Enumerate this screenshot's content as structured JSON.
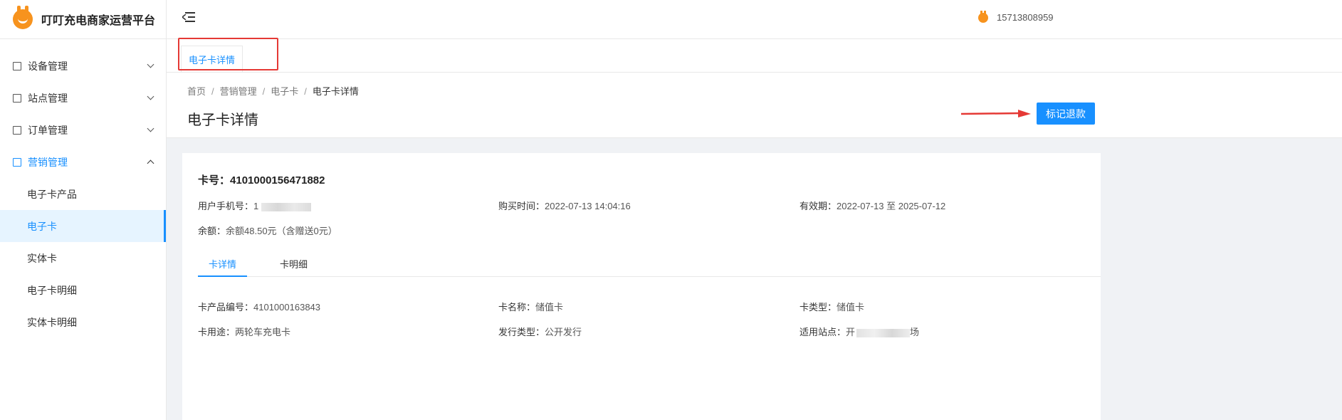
{
  "brand": {
    "title": "叮叮充电商家运营平台",
    "logo_icon": "plug-smile-logo"
  },
  "sidebar": {
    "items": [
      {
        "label": "设备管理",
        "icon": "device-icon"
      },
      {
        "label": "站点管理",
        "icon": "site-icon"
      },
      {
        "label": "订单管理",
        "icon": "order-icon"
      },
      {
        "label": "营销管理",
        "icon": "gift-icon"
      }
    ],
    "submenu": [
      {
        "label": "电子卡产品"
      },
      {
        "label": "电子卡"
      },
      {
        "label": "实体卡"
      },
      {
        "label": "电子卡明细"
      },
      {
        "label": "实体卡明细"
      }
    ]
  },
  "header": {
    "user_phone": "15713808959"
  },
  "tabs": {
    "open_tab": "电子卡详情"
  },
  "breadcrumb": [
    "首页",
    "营销管理",
    "电子卡",
    "电子卡详情"
  ],
  "page": {
    "title": "电子卡详情",
    "refund_button": "标记退款"
  },
  "card": {
    "number_label": "卡号：",
    "number": "4101000156471882",
    "phone_label": "用户手机号：",
    "phone_prefix": "1",
    "purchase_label": "购买时间：",
    "purchase_time": "2022-07-13 14:04:16",
    "validity_label": "有效期：",
    "validity": "2022-07-13 至 2025-07-12",
    "balance_label": "余额：",
    "balance": "余额48.50元（含赠送0元）"
  },
  "inner_tabs": [
    "卡详情",
    "卡明细"
  ],
  "details": {
    "product_no_label": "卡产品编号：",
    "product_no": "4101000163843",
    "name_label": "卡名称：",
    "name": "储值卡",
    "type_label": "卡类型：",
    "type": "储值卡",
    "usage_label": "卡用途：",
    "usage": "两轮车充电卡",
    "issue_label": "发行类型：",
    "issue": "公开发行",
    "station_label": "适用站点：",
    "station_prefix": "开",
    "station_suffix": "场"
  },
  "colors": {
    "accent": "#1890ff",
    "brand": "#f7931e",
    "annotation": "#e53935"
  }
}
